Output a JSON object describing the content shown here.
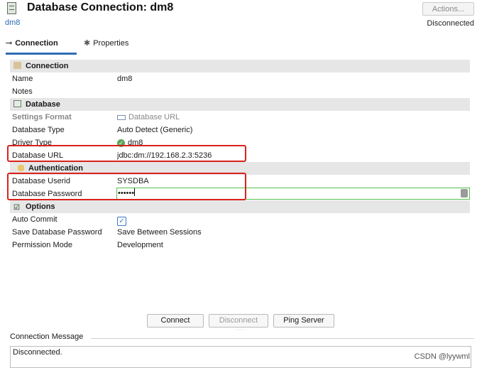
{
  "header": {
    "title": "Database Connection: dm8",
    "subtitle": "dm8",
    "actions_label": "Actions...",
    "status": "Disconnected"
  },
  "tabs": [
    {
      "label": "Connection",
      "icon": "connection-icon"
    },
    {
      "label": "Properties",
      "icon": "properties-icon"
    }
  ],
  "form": {
    "connection": {
      "section": "Connection",
      "name_label": "Name",
      "name_value": "dm8",
      "notes_label": "Notes",
      "notes_value": ""
    },
    "database": {
      "section": "Database",
      "settings_format_label": "Settings Format",
      "settings_format_value": "Database URL",
      "type_label": "Database Type",
      "type_value": "Auto Detect (Generic)",
      "driver_label": "Driver Type",
      "driver_value": "dm8",
      "url_label": "Database URL",
      "url_value": "jdbc:dm://192.168.2.3:5236"
    },
    "authentication": {
      "section": "Authentication",
      "userid_label": "Database Userid",
      "userid_value": "SYSDBA",
      "password_label": "Database Password",
      "password_value": "••••••"
    },
    "options": {
      "section": "Options",
      "auto_commit_label": "Auto Commit",
      "auto_commit_checked": true,
      "save_password_label": "Save Database Password",
      "save_password_value": "Save Between Sessions",
      "permission_label": "Permission Mode",
      "permission_value": "Development"
    }
  },
  "buttons": {
    "connect": "Connect",
    "disconnect": "Disconnect",
    "ping": "Ping Server"
  },
  "message": {
    "title": "Connection Message",
    "text": "Disconnected."
  },
  "watermark": "CSDN @lyywml",
  "colors": {
    "accent": "#2f6db4",
    "highlight": "#d9221b",
    "section_bg": "#e6e6e6",
    "focus_border": "#56c04c"
  }
}
